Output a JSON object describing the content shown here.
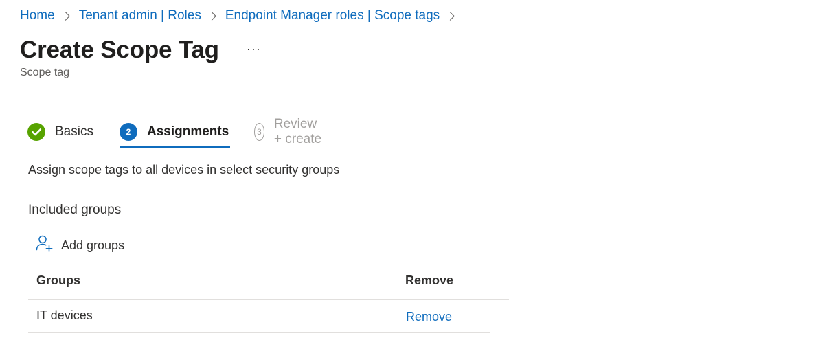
{
  "breadcrumb": {
    "items": [
      "Home",
      "Tenant admin | Roles",
      "Endpoint Manager roles | Scope tags"
    ]
  },
  "header": {
    "title": "Create Scope Tag",
    "more": "···",
    "subtitle": "Scope tag"
  },
  "steps": [
    {
      "label": "Basics",
      "status": "complete",
      "number": "1"
    },
    {
      "label": "Assignments",
      "status": "current",
      "number": "2"
    },
    {
      "label": "Review + create",
      "status": "upcoming",
      "number": "3"
    }
  ],
  "main": {
    "description": "Assign scope tags to all devices in select security groups",
    "included_groups_label": "Included groups",
    "add_groups_label": "Add groups",
    "table": {
      "columns": [
        "Groups",
        "Remove"
      ],
      "rows": [
        {
          "group": "IT devices",
          "action": "Remove"
        }
      ]
    }
  },
  "colors": {
    "accent": "#0f6cbd",
    "success": "#57a300",
    "muted": "#a19f9d"
  },
  "icons": {
    "check": "checkmark-icon",
    "add_user": "add-person-icon",
    "chevron": "chevron-right-icon"
  }
}
